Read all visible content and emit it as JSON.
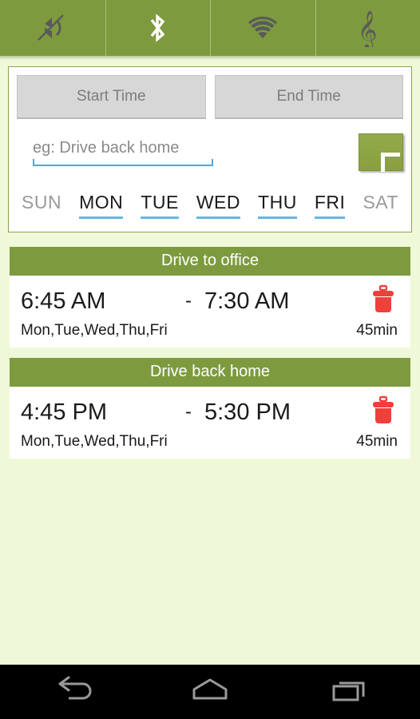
{
  "tabbar": {
    "tabs": [
      {
        "icon": "volume-mute-icon",
        "name": "tab-silent",
        "active": false
      },
      {
        "icon": "bluetooth-icon",
        "name": "tab-bluetooth",
        "active": true
      },
      {
        "icon": "wifi-icon",
        "name": "tab-wifi",
        "active": false
      },
      {
        "icon": "music-note-icon",
        "name": "tab-music",
        "active": false
      }
    ],
    "bar_color": "#7d9b3e",
    "active_icon_color": "#ffffff",
    "inactive_icon_color": "#5a5a5a"
  },
  "form": {
    "start_time_label": "Start Time",
    "end_time_label": "End Time",
    "title_placeholder": "eg: Drive back home",
    "title_value": "",
    "add_label": "+",
    "days": [
      {
        "label": "SUN",
        "selected": false
      },
      {
        "label": "MON",
        "selected": true
      },
      {
        "label": "TUE",
        "selected": true
      },
      {
        "label": "WED",
        "selected": true
      },
      {
        "label": "THU",
        "selected": true
      },
      {
        "label": "FRI",
        "selected": true
      },
      {
        "label": "SAT",
        "selected": false
      }
    ],
    "underline_color": "#4da7de",
    "add_button_color": "#8a9f3f"
  },
  "schedules": [
    {
      "title": "Drive to office",
      "start": "6:45 AM",
      "dash": "-",
      "end": "7:30 AM",
      "days": "Mon,Tue,Wed,Thu,Fri",
      "duration": "45min",
      "delete_icon": "trash-icon"
    },
    {
      "title": "Drive back home",
      "start": "4:45 PM",
      "dash": "-",
      "end": "5:30 PM",
      "days": "Mon,Tue,Wed,Thu,Fri",
      "duration": "45min",
      "delete_icon": "trash-icon"
    }
  ],
  "navbar": {
    "back": "back-icon",
    "home": "home-icon",
    "recents": "recents-icon",
    "icon_color": "#9a9a9a",
    "background": "#000000"
  },
  "theme": {
    "page_background": "#f0f8da",
    "accent_green": "#7d9b3e",
    "card_background": "#ffffff",
    "trash_red": "#f0403c"
  }
}
